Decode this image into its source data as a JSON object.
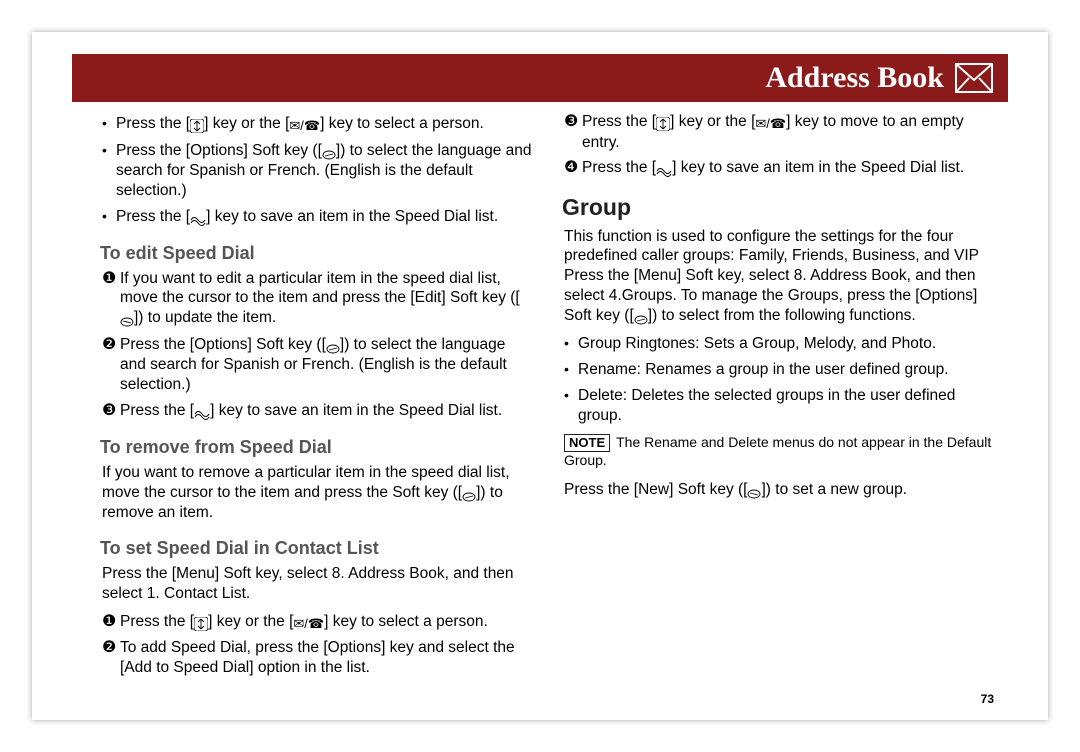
{
  "header": {
    "title": "Address Book"
  },
  "left": {
    "intro_bullets": [
      {
        "pre": "Press the [",
        "icon1": "updown",
        "mid": "] key or the [",
        "icon2": "msgphone",
        "post": "] key to select a person."
      },
      {
        "pre": "Press the [Options] Soft key ([",
        "icon1": "softkey-a",
        "post": "]) to select the language and search for Spanish or French. (English is the default selection.)"
      },
      {
        "pre": "Press the [",
        "icon1": "wave",
        "post": "] key to save an item in the Speed Dial list."
      }
    ],
    "edit_heading": "To edit Speed Dial",
    "edit_steps": [
      {
        "num": "❶",
        "pre": "If you want to edit a particular item in the speed dial list, move the cursor to the item and press the [Edit] Soft key ([",
        "icon1": "softkey-b",
        "post": "]) to update the item."
      },
      {
        "num": "❷",
        "pre": "Press the [Options] Soft key ([",
        "icon1": "softkey-a",
        "post": "]) to select the language and search for Spanish or French. (English is the default selection.)"
      },
      {
        "num": "❸",
        "pre": "Press the [",
        "icon1": "wave",
        "post": "] key to save an item in the Speed Dial list."
      }
    ],
    "remove_heading": "To remove from Speed Dial",
    "remove_para_pre": "If you want to remove a particular item in the speed dial list, move the cursor to the item and press the Soft key ([",
    "remove_para_post": "]) to remove an item.",
    "set_heading": "To set Speed Dial in Contact List",
    "set_para": "Press the [Menu] Soft key, select 8. Address Book, and then select 1. Contact List.",
    "set_step1_pre": "Press the [",
    "set_step1_mid": "] key or the [",
    "set_step1_post": "] key to select a person."
  },
  "right": {
    "cont_steps": [
      {
        "num": "❷",
        "text": "To add Speed Dial, press the [Options] key and select the [Add to Speed Dial] option in the list."
      },
      {
        "num": "❸",
        "pre": "Press the [",
        "icon1": "updown",
        "mid": "] key or the [",
        "icon2": "msgphone",
        "post": "] key to move to an empty entry."
      },
      {
        "num": "❹",
        "pre": "Press the [",
        "icon1": "wave",
        "post": "] key to save an item in the Speed Dial list."
      }
    ],
    "group_heading": "Group",
    "group_para_pre": "This function is used to configure the settings for the four predefined caller groups: Family, Friends, Business, and VIP Press the [Menu] Soft key, select 8. Address Book, and then select 4.Groups. To manage the Groups, press the [Options] Soft key ([",
    "group_para_post": "]) to select from the following functions.",
    "group_bullets": [
      "Group Ringtones: Sets a Group, Melody, and Photo.",
      "Rename: Renames a group in the user defined group.",
      "Delete: Deletes the selected groups in the user defined group."
    ],
    "note_label": "NOTE",
    "note_text": "The Rename and Delete menus do not appear in the Default Group.",
    "new_group_pre": "Press the [New] Soft key ([",
    "new_group_post": "]) to set a new group."
  },
  "pagenum": "73"
}
